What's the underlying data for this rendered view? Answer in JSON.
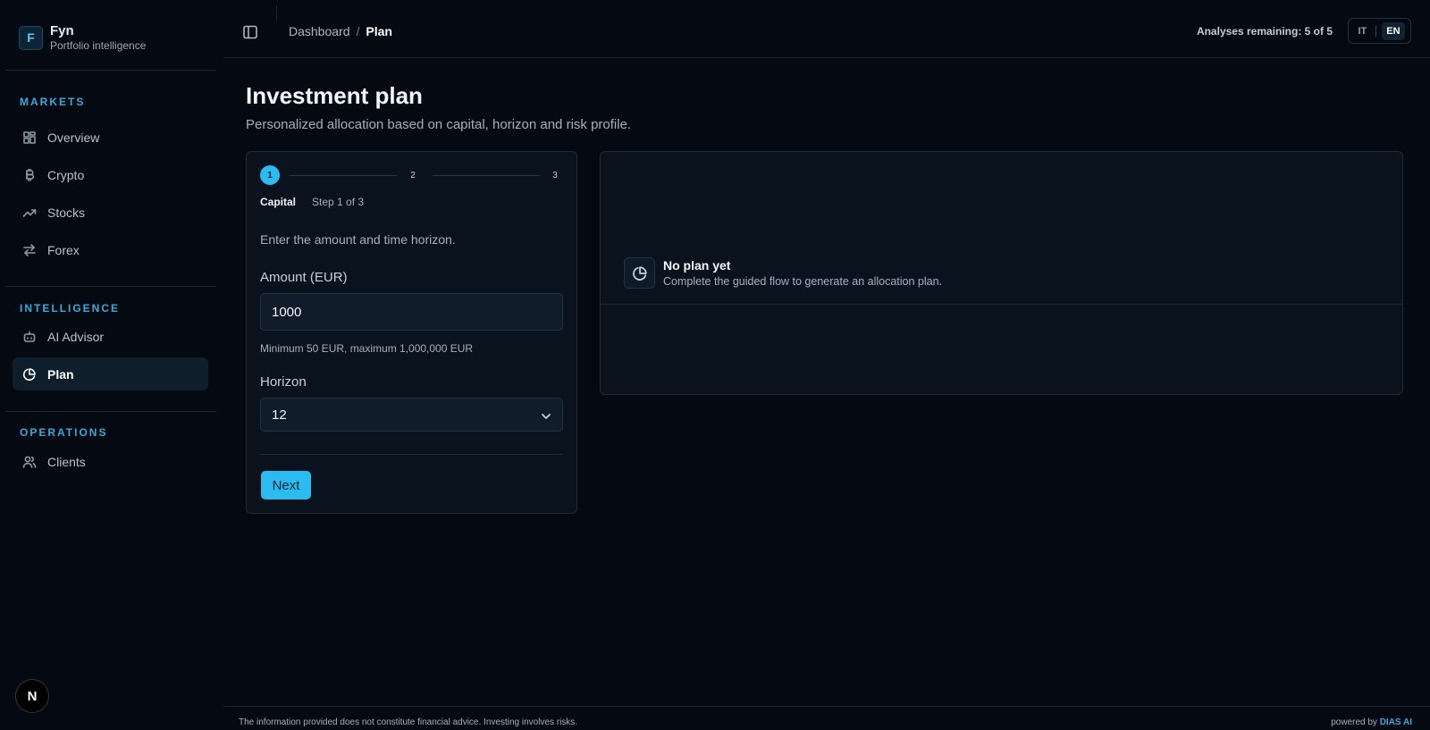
{
  "brand": {
    "logo_letter": "F",
    "name": "Fyn",
    "subtitle": "Portfolio intelligence"
  },
  "sidebar": {
    "sections": [
      {
        "label": "MARKETS",
        "items": [
          {
            "label": "Overview",
            "icon": "grid-icon"
          },
          {
            "label": "Crypto",
            "icon": "bitcoin-icon"
          },
          {
            "label": "Stocks",
            "icon": "trending-up-icon"
          },
          {
            "label": "Forex",
            "icon": "arrows-exchange-icon"
          }
        ]
      },
      {
        "label": "INTELLIGENCE",
        "items": [
          {
            "label": "AI Advisor",
            "icon": "bot-icon"
          },
          {
            "label": "Plan",
            "icon": "pie-chart-icon",
            "active": true
          }
        ]
      },
      {
        "label": "OPERATIONS",
        "items": [
          {
            "label": "Clients",
            "icon": "users-icon"
          }
        ]
      }
    ],
    "avatar_letter": "N"
  },
  "header": {
    "breadcrumb": {
      "parent": "Dashboard",
      "separator": "/",
      "current": "Plan"
    },
    "analyses_remaining": "Analyses remaining: 5 of 5",
    "languages": {
      "it": "IT",
      "en": "EN",
      "active": "EN"
    }
  },
  "main": {
    "title": "Investment plan",
    "subtitle": "Personalized allocation based on capital, horizon and risk profile.",
    "wizard": {
      "steps": [
        "1",
        "2",
        "3"
      ],
      "active_step": 1,
      "step_name": "Capital",
      "step_count": "Step 1 of 3",
      "description": "Enter the amount and time horizon.",
      "amount": {
        "label": "Amount (EUR)",
        "value": "1000",
        "help": "Minimum 50 EUR, maximum 1,000,000 EUR"
      },
      "horizon": {
        "label": "Horizon",
        "value": "12"
      },
      "next_label": "Next"
    },
    "result": {
      "empty_title": "No plan yet",
      "empty_subtitle": "Complete the guided flow to generate an allocation plan."
    }
  },
  "footer": {
    "disclaimer": "The information provided does not constitute financial advice. Investing involves risks.",
    "powered_prefix": "powered by",
    "powered_brand": "DIAS AI"
  },
  "colors": {
    "accent": "#2bbbf0",
    "section_label": "#3aa9d8",
    "background": "#050a12",
    "panel": "#0a131d"
  }
}
